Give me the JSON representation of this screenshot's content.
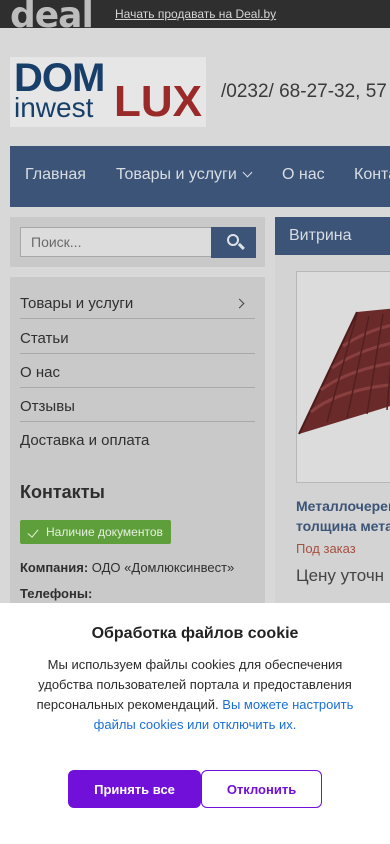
{
  "topbar": {
    "logo": "deal",
    "sell_link": "Начать продавать на Deal.by"
  },
  "brand": {
    "dom": "DOM",
    "inwest": "inwest",
    "lux": "LUX"
  },
  "header": {
    "phone": "/0232/ 68-27-32, 57"
  },
  "nav": {
    "home": "Главная",
    "goods": "Товары и услуги",
    "about": "О нас",
    "contacts": "Конта"
  },
  "search": {
    "placeholder": "Поиск..."
  },
  "sidebar": {
    "menu": [
      "Товары и услуги",
      "Статьи",
      "О нас",
      "Отзывы",
      "Доставка и оплата"
    ],
    "contacts_title": "Контакты",
    "docs_badge": "Наличие документов",
    "company_label": "Компания:",
    "company_value": "ОДО «Домлюксинвест»",
    "phones_label": "Телефоны:"
  },
  "showcase": {
    "title": "Витрина",
    "product_line1": "Металлочерепи",
    "product_line2": "толщина мета",
    "order": "Под заказ",
    "price": "Цену уточн"
  },
  "cookie": {
    "title": "Обработка файлов cookie",
    "text": "Мы используем файлы cookies для обеспечения удобства пользователей портала и предоставления персональных рекомендаций.",
    "link": "Вы можете настроить файлы cookies или отключить их.",
    "accept": "Принять все",
    "decline": "Отклонить"
  },
  "colors": {
    "nav": "#3b5477",
    "accent": "#7010d9",
    "badge": "#5f9f3b",
    "brand_red": "#9a2a2a"
  }
}
